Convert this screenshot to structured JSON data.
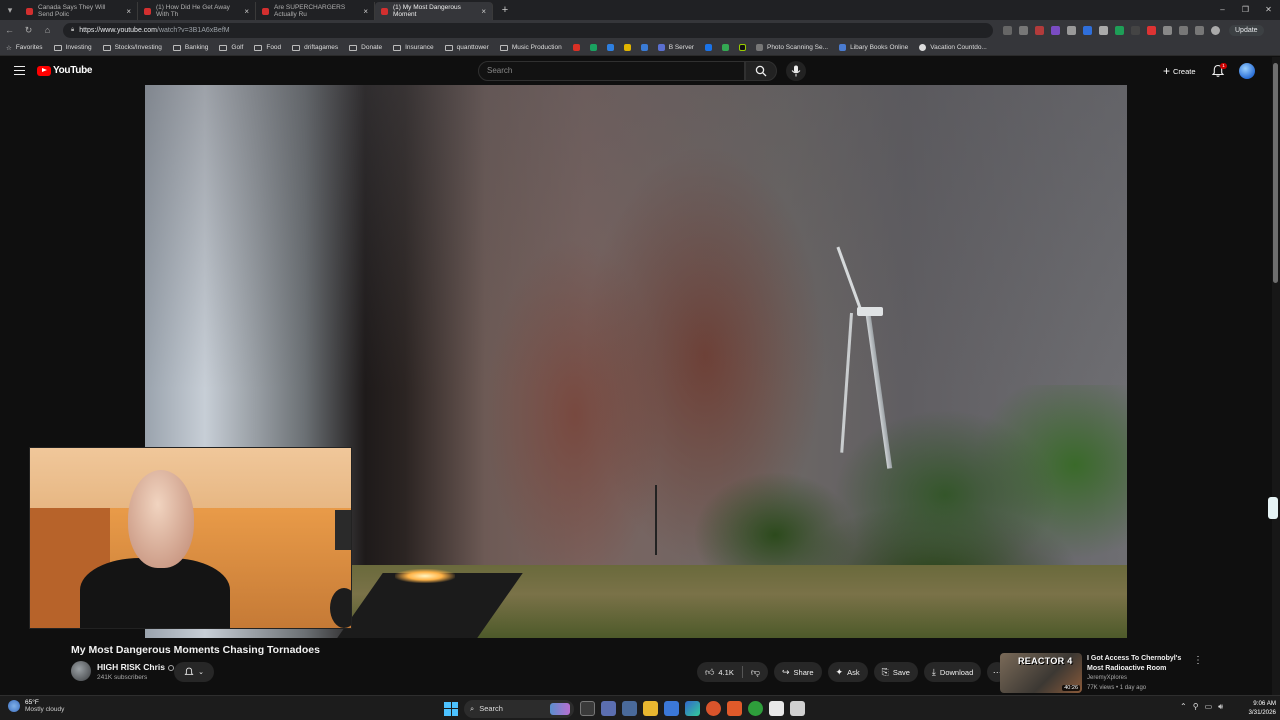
{
  "browser": {
    "tabs": [
      {
        "title": "Canada Says They Will Send Polic",
        "active": false
      },
      {
        "title": "(1) How Did He Get Away With Th",
        "active": false
      },
      {
        "title": "Are SUPERCHARGERS Actually Ru",
        "active": false
      },
      {
        "title": "(1) My Most Dangerous Moment",
        "active": true
      }
    ],
    "new_tab": "+",
    "url_domain": "https://www.youtube.com",
    "url_path": "/watch?v=3B1A6xBefM",
    "update_label": "Update",
    "bookmarks": [
      {
        "label": "Favorites",
        "type": "star"
      },
      {
        "label": "Investing",
        "type": "folder"
      },
      {
        "label": "Stocks/Investing",
        "type": "folder"
      },
      {
        "label": "Banking",
        "type": "folder"
      },
      {
        "label": "Golf",
        "type": "folder"
      },
      {
        "label": "Food",
        "type": "folder"
      },
      {
        "label": "driftagames",
        "type": "folder"
      },
      {
        "label": "Donate",
        "type": "folder"
      },
      {
        "label": "Insurance",
        "type": "folder"
      },
      {
        "label": "quanttower",
        "type": "folder"
      },
      {
        "label": "Music Production",
        "type": "folder"
      },
      {
        "label": "B Server",
        "type": "site"
      },
      {
        "label": "Photo Scanning Se...",
        "type": "site"
      },
      {
        "label": "Libary Books Online",
        "type": "site"
      },
      {
        "label": "Vacation Countdo...",
        "type": "site"
      }
    ]
  },
  "youtube": {
    "logo_text": "YouTube",
    "search_placeholder": "Search",
    "create_label": "Create",
    "notification_count": "1"
  },
  "video": {
    "title": "My Most Dangerous Moments Chasing Tornadoes",
    "channel_name": "HIGH RISK Chris",
    "subscribers": "241K subscribers",
    "like_count": "4.1K",
    "share_label": "Share",
    "ask_label": "Ask",
    "save_label": "Save",
    "download_label": "Download"
  },
  "recommended": {
    "thumb_text": "REACTOR 4",
    "duration": "40:26",
    "title": "I Got Access To Chernobyl's Most Radioactive Room",
    "channel": "JeremyXplores",
    "meta": "77K views • 1 day ago"
  },
  "taskbar": {
    "temperature": "65°F",
    "weather": "Mostly cloudy",
    "search_label": "Search",
    "time": "9:06 AM",
    "date": "3/31/2026"
  },
  "colors": {
    "yt_red": "#ff0000",
    "background": "#0f0f0f",
    "pill_bg": "#272727"
  }
}
